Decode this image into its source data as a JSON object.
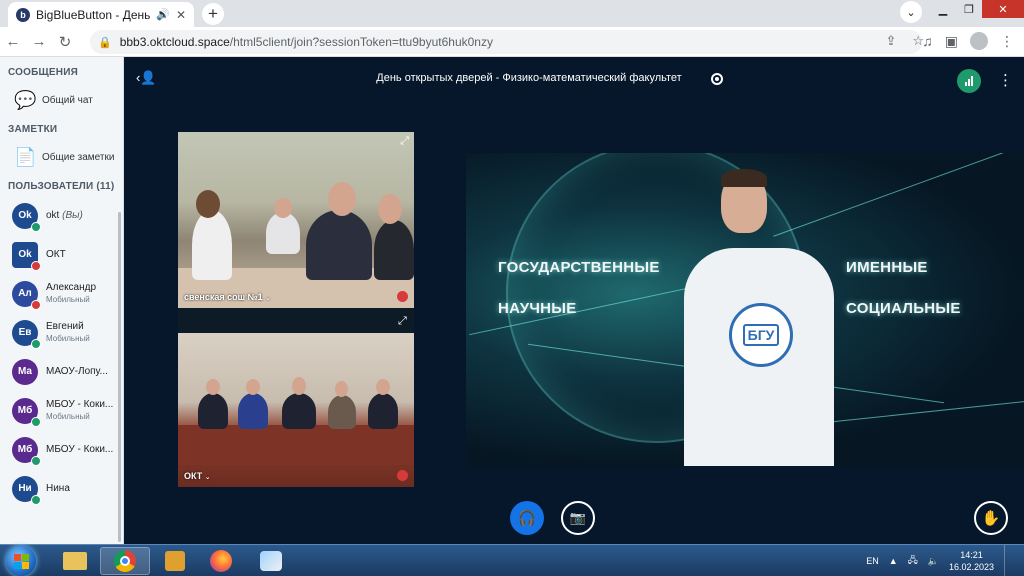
{
  "browser": {
    "tab_title": "BigBlueButton - День открытых",
    "favicon_letter": "b",
    "url_host": "bbb3.oktcloud.space",
    "url_path": "/html5client/join?sessionToken=ttu9byut6huk0nzy",
    "tab_close": "✕",
    "new_tab": "+"
  },
  "sidebar": {
    "messages_title": "СООБЩЕНИЯ",
    "public_chat": "Общий чат",
    "notes_title": "ЗАМЕТКИ",
    "shared_notes": "Общие заметки",
    "users_title": "ПОЛЬЗОВАТЕЛИ (11)",
    "users": [
      {
        "initials": "Ok",
        "name": "okt",
        "you": "(Вы)",
        "sub": "",
        "color": "#1e4b8f",
        "shape": "round",
        "mic": "#1f9a6b"
      },
      {
        "initials": "Ok",
        "name": "ОКТ",
        "you": "",
        "sub": "",
        "color": "#1e4b8f",
        "shape": "square",
        "mic": "#d63a3a"
      },
      {
        "initials": "Ал",
        "name": "Александр",
        "you": "",
        "sub": "Мобильный",
        "color": "#2d4b9e",
        "shape": "round",
        "mic": "#d63a3a"
      },
      {
        "initials": "Ев",
        "name": "Евгений",
        "you": "",
        "sub": "Мобильный",
        "color": "#1e4b8f",
        "shape": "round",
        "mic": "#1f9a6b"
      },
      {
        "initials": "Ма",
        "name": "МАОУ-Лопу...",
        "you": "",
        "sub": "",
        "color": "#5a2a8e",
        "shape": "round",
        "mic": ""
      },
      {
        "initials": "Мб",
        "name": "МБОУ - Коки...",
        "you": "",
        "sub": "Мобильный",
        "color": "#5a2a8e",
        "shape": "round",
        "mic": "#1f9a6b"
      },
      {
        "initials": "Мб",
        "name": "МБОУ - Коки...",
        "you": "",
        "sub": "",
        "color": "#5a2a8e",
        "shape": "round",
        "mic": "#1f9a6b"
      },
      {
        "initials": "Ни",
        "name": "Нина",
        "you": "",
        "sub": "",
        "color": "#1e4b8f",
        "shape": "round",
        "mic": "#1f9a6b"
      }
    ]
  },
  "meeting": {
    "title": "День открытых дверей - Физико-математический факультет"
  },
  "webcams": [
    {
      "label": "свенская сош №1"
    },
    {
      "label": "ОКТ"
    }
  ],
  "slide": {
    "words": [
      "ГОСУДАРСТВЕННЫЕ",
      "НАУЧНЫЕ",
      "ИМЕННЫЕ",
      "СОЦИАЛЬНЫЕ"
    ],
    "shirt_logo": "БГУ"
  },
  "taskbar": {
    "lang": "EN",
    "time": "14:21",
    "date": "16.02.2023"
  },
  "colors": {
    "accent": "#1473e6",
    "background": "#06172b",
    "sidebar": "#f3f6f9",
    "connection": "#1f9a6b"
  }
}
